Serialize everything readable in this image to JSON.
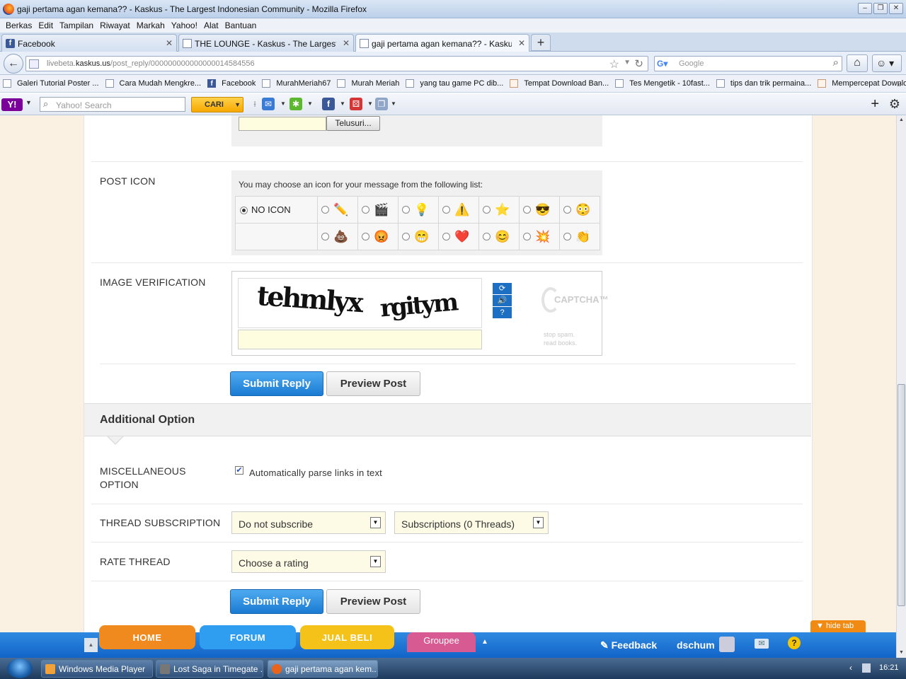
{
  "window": {
    "title": "gaji pertama agan kemana?? - Kaskus - The Largest Indonesian Community - Mozilla Firefox",
    "controls": [
      "–",
      "❐",
      "✕"
    ]
  },
  "menu": [
    "Berkas",
    "Edit",
    "Tampilan",
    "Riwayat",
    "Markah",
    "Yahoo!",
    "Alat",
    "Bantuan"
  ],
  "tabs": [
    {
      "label": "Facebook",
      "icon": "facebook-icon"
    },
    {
      "label": "THE LOUNGE - Kaskus - The Largest Indo...",
      "icon": "page-icon"
    },
    {
      "label": "gaji pertama agan kemana?? - Kaskus - T...",
      "icon": "page-icon",
      "active": true
    }
  ],
  "nav": {
    "url_domain_prefix": "livebeta.",
    "url_domain": "kaskus.us",
    "url_path": "/post_reply/000000000000000014584556",
    "search_placeholder": "Google"
  },
  "bookmarks": [
    {
      "label": "Galeri Tutorial Poster ...",
      "icon": "page"
    },
    {
      "label": "Cara Mudah Mengkre...",
      "icon": "page"
    },
    {
      "label": "Facebook",
      "icon": "facebook"
    },
    {
      "label": "MurahMeriah67",
      "icon": "page"
    },
    {
      "label": "Murah Meriah",
      "icon": "page"
    },
    {
      "label": "yang tau game PC dib...",
      "icon": "page"
    },
    {
      "label": "Tempat Download Ban...",
      "icon": "site"
    },
    {
      "label": "Tes Mengetik - 10fast...",
      "icon": "page"
    },
    {
      "label": "tips dan trik permaina...",
      "icon": "page"
    },
    {
      "label": "Mempercepat Downlo...",
      "icon": "site"
    }
  ],
  "yahoo": {
    "logo": "Y!",
    "search_placeholder": "Yahoo! Search",
    "search_button": "CARI"
  },
  "form": {
    "browse_button": "Telusuri...",
    "post_icon_label": "POST ICON",
    "post_icon_hint": "You may choose an icon for your message from the following list:",
    "no_icon_label": "NO ICON",
    "icons_row1": [
      "✏️",
      "🎬",
      "💡",
      "⚠️",
      "⭐",
      "😎",
      "😳"
    ],
    "icons_row2": [
      "💩",
      "😡",
      "😁",
      "❤️",
      "😊",
      "💥",
      "👏"
    ],
    "image_verification_label": "IMAGE VERIFICATION",
    "captcha_word1": "tehmlyx",
    "captcha_word2": "rgitym",
    "recaptcha_brand": "CAPTCHA™",
    "recaptcha_tagline_1": "stop spam.",
    "recaptcha_tagline_2": "read books.",
    "submit_label": "Submit Reply",
    "preview_label": "Preview Post",
    "additional_option_title": "Additional Option",
    "misc_label_1": "MISCELLANEOUS",
    "misc_label_2": "OPTION",
    "parse_links_label": "Automatically parse links in text",
    "parse_links_checked": true,
    "thread_subscription_label": "THREAD SUBSCRIPTION",
    "subscription_value": "Do not subscribe",
    "subscriptions_count_value": "Subscriptions (0 Threads)",
    "rate_thread_label": "RATE THREAD",
    "rating_value": "Choose a rating"
  },
  "kaskus_bar": {
    "hide_tab": "▼  hide tab",
    "tabs": [
      "HOME",
      "FORUM",
      "JUAL BELI"
    ],
    "tab_colors": [
      "#f08a1e",
      "#2f9ef0",
      "#f5c21a"
    ],
    "groupee": "Groupee",
    "feedback": "Feedback",
    "username": "dschum"
  },
  "taskbar": {
    "items": [
      "Windows Media Player",
      "Lost Saga in Timegate ...",
      "gaji pertama agan kem..."
    ],
    "clock": "16:21"
  }
}
